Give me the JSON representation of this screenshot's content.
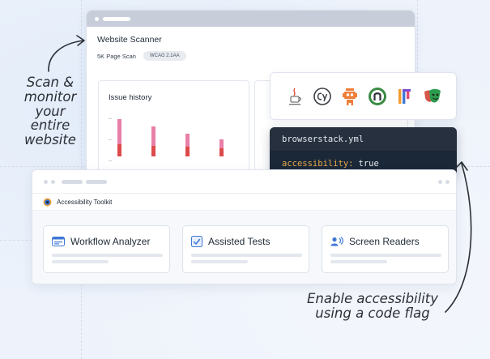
{
  "annotations": {
    "left_lines": [
      "Scan &",
      "monitor",
      "your",
      "entire",
      "website"
    ],
    "bottom_lines": [
      "Enable accessibility",
      "using a code flag"
    ]
  },
  "scanner": {
    "title": "Website Scanner",
    "scan_label": "5K Page Scan",
    "badge": "WCAG 2.1AA",
    "issue_history_title": "Issue history",
    "bar_colors": {
      "top": "#e77fa7",
      "bottom": "#dd4a4a"
    }
  },
  "integrations": {
    "icons": [
      "selenium-icon",
      "cypress-icon",
      "robot-framework-icon",
      "nightwatch-icon",
      "webdriverio-icon",
      "playwright-icon"
    ],
    "colors": {
      "cypress": "#3c3f46",
      "robot": "#ee7f39",
      "nightwatch": "#3a8a43",
      "playwright": "#2d9b4e"
    }
  },
  "code": {
    "filename": "browserstack.yml",
    "key": "accessibility:",
    "value": "true",
    "colors": {
      "background": "#1b2838",
      "header": "#26303e",
      "key": "#e6a94b",
      "value": "#e5e9f0"
    }
  },
  "toolkit": {
    "title": "Accessibility Toolkit",
    "features": [
      {
        "label": "Workflow Analyzer",
        "icon": "workflow-icon"
      },
      {
        "label": "Assisted Tests",
        "icon": "checklist-icon"
      },
      {
        "label": "Screen Readers",
        "icon": "screen-reader-icon"
      }
    ],
    "accent": "#3f77d6"
  }
}
